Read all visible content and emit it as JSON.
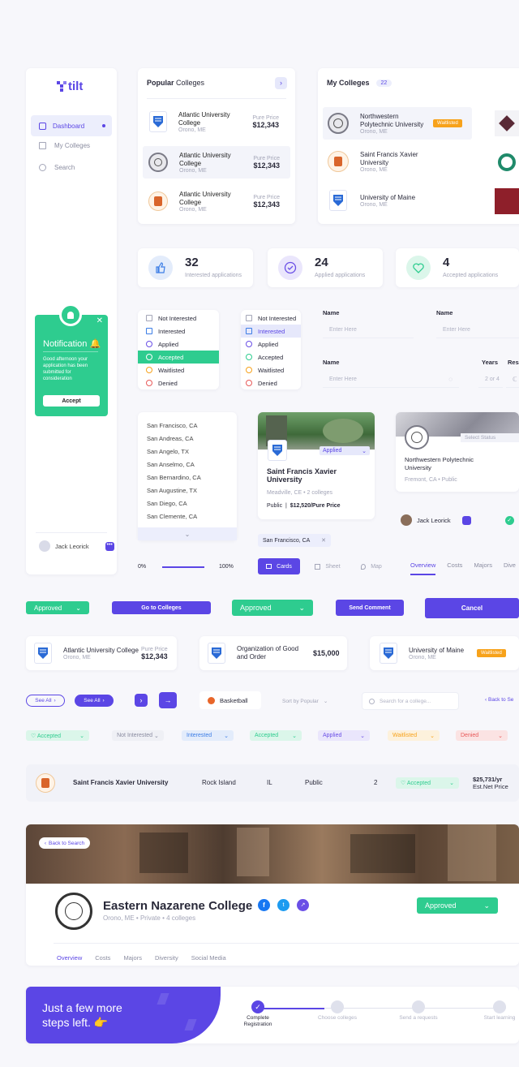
{
  "brand": {
    "name": "tilt"
  },
  "sidebar": {
    "items": [
      {
        "label": "Dashboard",
        "icon": "dashboard-icon"
      },
      {
        "label": "My Colleges",
        "icon": "grid-icon"
      },
      {
        "label": "Search",
        "icon": "search-icon"
      }
    ],
    "user": {
      "name": "Jack Leorick"
    }
  },
  "notification": {
    "title": "Notification 🔔",
    "body": "Good afternoon your application has been submitted for consideration",
    "button": "Accept"
  },
  "popular": {
    "title_bold": "Popular",
    "title_rest": "Colleges",
    "items": [
      {
        "name": "Atlantic University College",
        "loc": "Orono, ME",
        "price_label": "Pure Price",
        "price": "$12,343"
      },
      {
        "name": "Atlantic University College",
        "loc": "Orono, ME",
        "price_label": "Pure Price",
        "price": "$12,343"
      },
      {
        "name": "Atlantic University College",
        "loc": "Orono, ME",
        "price_label": "Pure Price",
        "price": "$12,343"
      }
    ]
  },
  "my_colleges": {
    "title": "My Colleges",
    "count": "22",
    "items": [
      {
        "name": "Northwestern Polytechnic University",
        "loc": "Orono, ME",
        "badge": "Waitlisted"
      },
      {
        "name": "Saint Francis Xavier University",
        "loc": "Orono, ME"
      },
      {
        "name": "University of Maine",
        "loc": "Orono, ME"
      }
    ]
  },
  "stats": [
    {
      "value": "32",
      "label": "Interested applications"
    },
    {
      "value": "24",
      "label": "Applied applications"
    },
    {
      "value": "4",
      "label": "Accepted applications"
    }
  ],
  "status_menu_1": [
    "Not Interested",
    "Interested",
    "Applied",
    "Accepted",
    "Waitlisted",
    "Denied"
  ],
  "status_menu_2": [
    "Not Interested",
    "Interested",
    "Applied",
    "Accepted",
    "Waitlisted",
    "Denied"
  ],
  "form": {
    "name_label": "Name",
    "name_placeholder": "Enter Here",
    "years_label": "Years",
    "years_placeholder": "2 or 4",
    "resi_label": "Resi"
  },
  "cities": [
    "San Francisco, CA",
    "San Andreas, CA",
    "San Angelo, TX",
    "San Anselmo, CA",
    "San Bernardino, CA",
    "San Augustine, TX",
    "San Diego, CA",
    "San Clemente, CA"
  ],
  "college_card": {
    "status": "Applied",
    "name": "Saint Francis Xavier University",
    "loc": "Meadville, CE",
    "colleges": "2 colleges",
    "type": "Public",
    "price": "$12,520/Pure Price"
  },
  "college_card_2": {
    "select_status": "Select Status",
    "name": "Northwestern Polytechnic University",
    "loc": "Fremont, CA",
    "type": "Public"
  },
  "user_row": {
    "name": "Jack Leorick"
  },
  "chip": {
    "label": "San Francisco, CA"
  },
  "range": {
    "min": "0%",
    "max": "100%",
    "fraction": 1.0
  },
  "view_toggle": {
    "cards": "Cards",
    "sheet": "Sheet",
    "map": "Map"
  },
  "tabs_small": [
    "Overview",
    "Costs",
    "Majors",
    "Dive"
  ],
  "buttons": {
    "approved": "Approved",
    "go_to_colleges": "Go to Colleges",
    "send_comment": "Send Comment",
    "cancel": "Cancel"
  },
  "college_strip": [
    {
      "name": "Atlantic University College",
      "loc": "Orono, ME",
      "price_label": "Pure Price",
      "price": "$12,343"
    },
    {
      "name": "Organization of Good and Order",
      "price": "$15,000"
    },
    {
      "name": "University of Maine",
      "loc": "Orono, ME",
      "badge": "Waitlisted"
    }
  ],
  "controls": {
    "see_all": "See All",
    "see_all_2": "See All",
    "basketball": "Basketball",
    "sort": "Sort by Popular",
    "search_placeholder": "Search for a college...",
    "back": "Back to Se"
  },
  "status_pills": [
    "Accepted",
    "Not Interested",
    "Interested",
    "Accepted",
    "Applied",
    "Waitlisted",
    "Denied"
  ],
  "table_row": {
    "name": "Saint Francis Xavier University",
    "city": "Rock Island",
    "state": "IL",
    "type": "Public",
    "years": "2",
    "status": "Accepted",
    "price": "$25,731/yr",
    "price_label": "Est.Net Price"
  },
  "profile": {
    "back": "Back to Search",
    "name": "Eastern Nazarene College",
    "loc": "Orono, ME",
    "type": "Private",
    "colleges": "4 colleges",
    "status": "Approved",
    "tabs": [
      "Overview",
      "Costs",
      "Majors",
      "Diversity",
      "Social Media"
    ]
  },
  "onboarding": {
    "line1": "Just a few more",
    "line2": "steps left. 👉",
    "steps": [
      "Complete Registration",
      "Choose colleges",
      "Send a requests",
      "Start learning"
    ]
  },
  "colors": {
    "accent": "#5b46e5",
    "green": "#2ecc8f",
    "orange": "#f7a21b"
  }
}
